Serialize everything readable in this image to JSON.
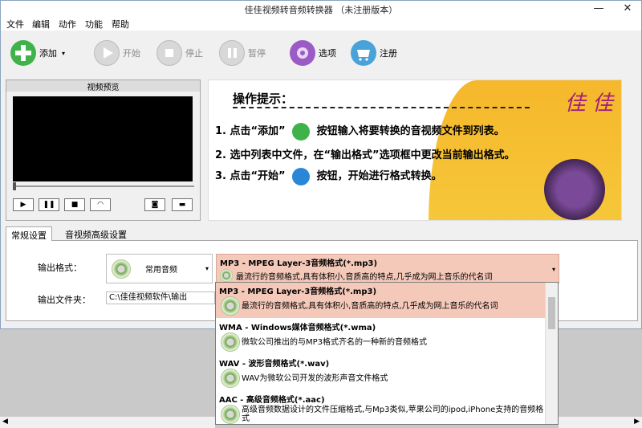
{
  "window": {
    "title": "佳佳视频转音频转换器 （未注册版本）",
    "minimize": "—",
    "close": "✕"
  },
  "menu": [
    "文件",
    "编辑",
    "动作",
    "功能",
    "帮助"
  ],
  "toolbar": {
    "add": "添加",
    "start": "开始",
    "stop": "停止",
    "pause": "暂停",
    "options": "选项",
    "register": "注册"
  },
  "preview": {
    "title": "视频预览"
  },
  "banner": {
    "heading": "操作提示：",
    "line1": "1. 点击“添加”",
    "line1b": "按钮输入将要转换的音视频文件到列表。",
    "line2": "2. 选中列表中文件，在“输出格式”选项框中更改当前输出格式。",
    "line3": "3. 点击“开始”",
    "line3b": "按钮，开始进行格式转换。",
    "brand": "佳 佳"
  },
  "tabs": [
    "常规设置",
    "音视频高级设置"
  ],
  "settings": {
    "output_format_label": "输出格式：",
    "category": "常用音频",
    "selected_format_name": "MP3 - MPEG Layer-3音频格式(*.mp3)",
    "selected_format_desc": "最流行的音频格式,具有体积小,音质高的特点,几乎成为网上音乐的代名词",
    "output_folder_label": "输出文件夹：",
    "output_folder": "C:\\佳佳视频软件\\输出"
  },
  "dropdown_options": [
    {
      "name": "MP3 - MPEG Layer-3音频格式(*.mp3)",
      "desc": "最流行的音频格式,具有体积小,音质高的特点,几乎成为网上音乐的代名词"
    },
    {
      "name": "WMA - Windows媒体音频格式(*.wma)",
      "desc": "微软公司推出的与MP3格式齐名的一种新的音频格式"
    },
    {
      "name": "WAV - 波形音频格式(*.wav)",
      "desc": "WAV为微软公司开发的波形声音文件格式"
    },
    {
      "name": "AAC - 高级音频格式(*.aac)",
      "desc": "高级音频数据设计的文件压缩格式,与Mp3类似,苹果公司的ipod,iPhone支持的音频格式"
    }
  ]
}
